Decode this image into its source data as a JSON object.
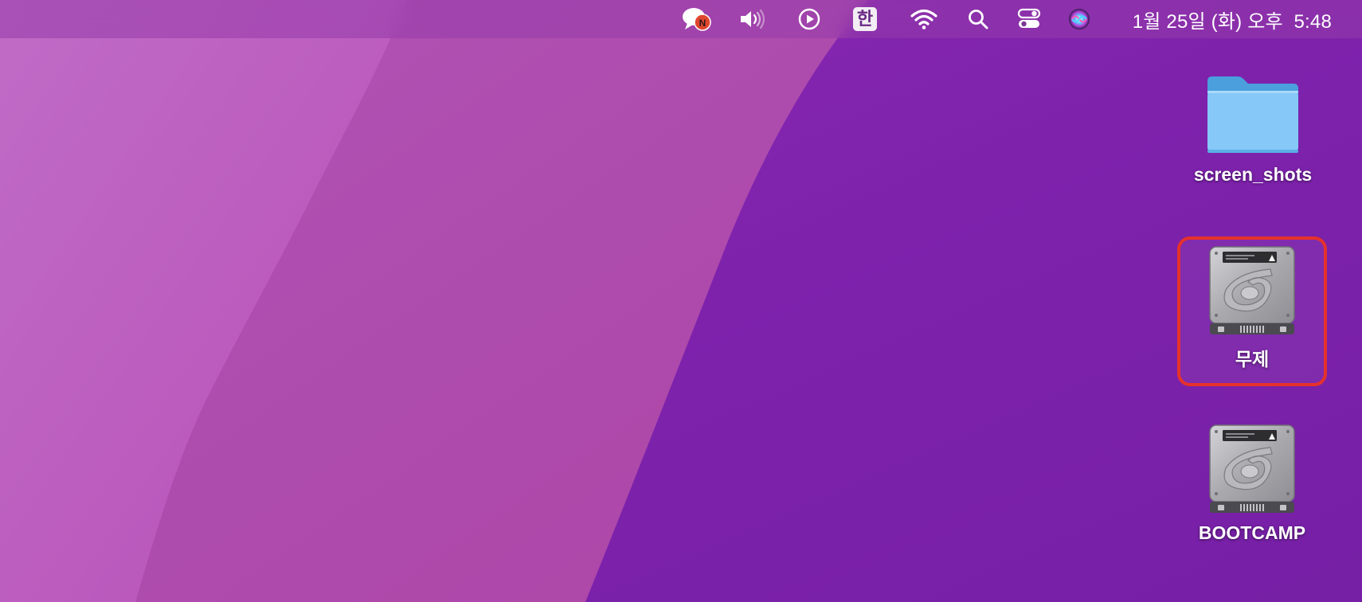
{
  "menubar": {
    "status_items": [
      {
        "icon": "chat-bubble-notification-icon",
        "badge": "N"
      },
      {
        "icon": "volume-icon"
      },
      {
        "icon": "play-circle-icon"
      },
      {
        "icon": "input-source-icon",
        "label": "한"
      },
      {
        "icon": "wifi-icon"
      },
      {
        "icon": "spotlight-search-icon"
      },
      {
        "icon": "control-center-icon"
      },
      {
        "icon": "siri-icon"
      }
    ],
    "clock": "1월 25일 (화) 오후  5:48"
  },
  "desktop": {
    "icons": [
      {
        "name": "screen_shots",
        "type": "folder-icon",
        "selected": false
      },
      {
        "name": "무제",
        "type": "hard-drive-icon",
        "selected": true
      },
      {
        "name": "BOOTCAMP",
        "type": "hard-drive-icon",
        "selected": false
      }
    ]
  },
  "colors": {
    "selection_outline": "#e6322b",
    "wallpaper_base": "#7a22ac",
    "folder_blue": "#86c8f8"
  }
}
